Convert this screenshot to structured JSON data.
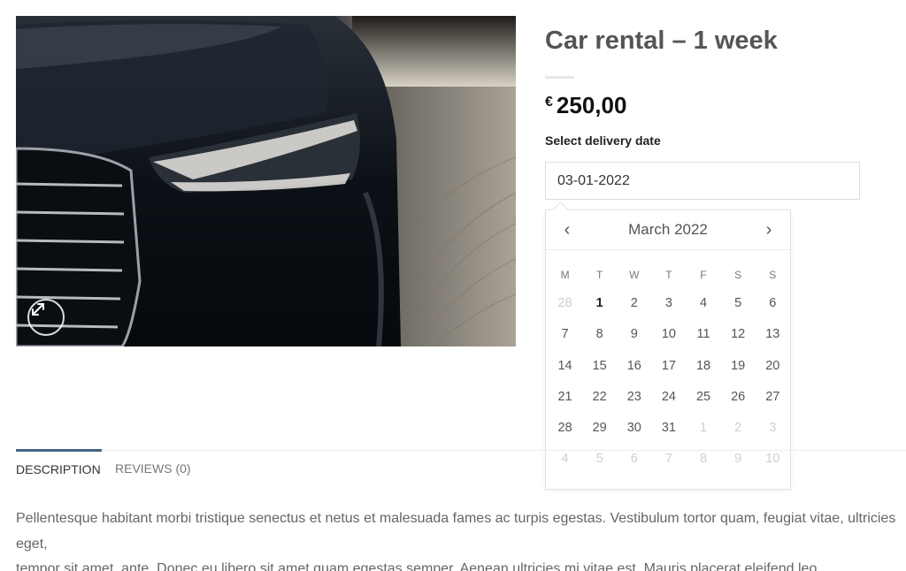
{
  "product": {
    "title": "Car rental – 1 week",
    "price": {
      "currency": "€",
      "amount": "250,00"
    },
    "image_alt": "black car front headlight"
  },
  "delivery": {
    "label": "Select delivery date",
    "value": "03-01-2022"
  },
  "datepicker": {
    "month_label": "March 2022",
    "prev": "‹",
    "next": "›",
    "weekdays": [
      "M",
      "T",
      "W",
      "T",
      "F",
      "S",
      "S"
    ],
    "days": [
      {
        "d": "28",
        "muted": true
      },
      {
        "d": "1",
        "today": true
      },
      {
        "d": "2"
      },
      {
        "d": "3"
      },
      {
        "d": "4"
      },
      {
        "d": "5"
      },
      {
        "d": "6"
      },
      {
        "d": "7"
      },
      {
        "d": "8"
      },
      {
        "d": "9"
      },
      {
        "d": "10"
      },
      {
        "d": "11"
      },
      {
        "d": "12"
      },
      {
        "d": "13"
      },
      {
        "d": "14"
      },
      {
        "d": "15"
      },
      {
        "d": "16"
      },
      {
        "d": "17"
      },
      {
        "d": "18"
      },
      {
        "d": "19"
      },
      {
        "d": "20"
      },
      {
        "d": "21"
      },
      {
        "d": "22"
      },
      {
        "d": "23"
      },
      {
        "d": "24"
      },
      {
        "d": "25"
      },
      {
        "d": "26"
      },
      {
        "d": "27"
      },
      {
        "d": "28"
      },
      {
        "d": "29"
      },
      {
        "d": "30"
      },
      {
        "d": "31"
      },
      {
        "d": "1",
        "muted": true
      },
      {
        "d": "2",
        "muted": true
      },
      {
        "d": "3",
        "muted": true
      },
      {
        "d": "4",
        "muted": true
      },
      {
        "d": "5",
        "muted": true
      },
      {
        "d": "6",
        "muted": true
      },
      {
        "d": "7",
        "muted": true
      },
      {
        "d": "8",
        "muted": true
      },
      {
        "d": "9",
        "muted": true
      },
      {
        "d": "10",
        "muted": true
      }
    ]
  },
  "tabs": [
    {
      "label": "DESCRIPTION",
      "active": true
    },
    {
      "label": "REVIEWS (0)",
      "active": false
    }
  ],
  "description": "Pellentesque habitant morbi tristique senectus et netus et malesuada fames ac turpis egestas. Vestibulum tortor quam, feugiat vitae, ultricies eget,\ntempor sit amet, ante. Donec eu libero sit amet quam egestas semper. Aenean ultricies mi vitae est. Mauris placerat eleifend leo.",
  "colors": {
    "tab_accent": "#446084",
    "title": "#555555",
    "price": "#111111"
  },
  "icons": {
    "zoom": "expand-arrows-icon",
    "prev": "chevron-left-icon",
    "next": "chevron-right-icon"
  }
}
